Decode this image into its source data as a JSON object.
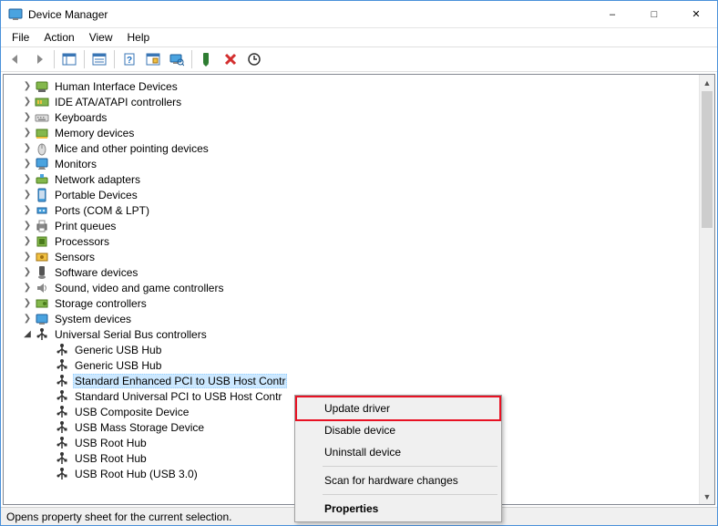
{
  "window": {
    "title": "Device Manager"
  },
  "menu": [
    "File",
    "Action",
    "View",
    "Help"
  ],
  "tree": {
    "items": [
      {
        "label": "Human Interface Devices",
        "icon": "hid"
      },
      {
        "label": "IDE ATA/ATAPI controllers",
        "icon": "ide"
      },
      {
        "label": "Keyboards",
        "icon": "keyboard"
      },
      {
        "label": "Memory devices",
        "icon": "memory"
      },
      {
        "label": "Mice and other pointing devices",
        "icon": "mouse"
      },
      {
        "label": "Monitors",
        "icon": "monitor"
      },
      {
        "label": "Network adapters",
        "icon": "network"
      },
      {
        "label": "Portable Devices",
        "icon": "portable"
      },
      {
        "label": "Ports (COM & LPT)",
        "icon": "port"
      },
      {
        "label": "Print queues",
        "icon": "printer"
      },
      {
        "label": "Processors",
        "icon": "cpu"
      },
      {
        "label": "Sensors",
        "icon": "sensor"
      },
      {
        "label": "Software devices",
        "icon": "software"
      },
      {
        "label": "Sound, video and game controllers",
        "icon": "sound"
      },
      {
        "label": "Storage controllers",
        "icon": "storage"
      },
      {
        "label": "System devices",
        "icon": "system"
      },
      {
        "label": "Universal Serial Bus controllers",
        "icon": "usb",
        "expanded": true,
        "children": [
          {
            "label": "Generic USB Hub",
            "icon": "usb"
          },
          {
            "label": "Generic USB Hub",
            "icon": "usb"
          },
          {
            "label": "Standard Enhanced PCI to USB Host Contr",
            "icon": "usb",
            "selected": true
          },
          {
            "label": "Standard Universal PCI to USB Host Contr",
            "icon": "usb"
          },
          {
            "label": "USB Composite Device",
            "icon": "usb"
          },
          {
            "label": "USB Mass Storage Device",
            "icon": "usb"
          },
          {
            "label": "USB Root Hub",
            "icon": "usb"
          },
          {
            "label": "USB Root Hub",
            "icon": "usb"
          },
          {
            "label": "USB Root Hub (USB 3.0)",
            "icon": "usb"
          }
        ]
      }
    ]
  },
  "context_menu": {
    "items": [
      {
        "label": "Update driver",
        "highlight": true
      },
      {
        "label": "Disable device"
      },
      {
        "label": "Uninstall device"
      },
      {
        "sep": true
      },
      {
        "label": "Scan for hardware changes"
      },
      {
        "sep": true
      },
      {
        "label": "Properties",
        "bold": true
      }
    ]
  },
  "statusbar": {
    "text": "Opens property sheet for the current selection."
  }
}
